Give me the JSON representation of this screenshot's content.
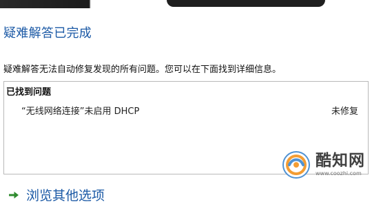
{
  "window": {
    "title": "疑难解答已完成"
  },
  "main": {
    "description": "疑难解答无法自动修复发现的所有问题。您可以在下面找到详细信息。",
    "problems_heading": "已找到问题",
    "problems": [
      {
        "name": "“无线网络连接”未启用 DHCP",
        "status": "未修复"
      }
    ]
  },
  "actions": {
    "browse_other_options": "浏览其他选项"
  },
  "watermark": {
    "name": "酷知网",
    "url": "www.coozhi.com"
  },
  "colors": {
    "title_blue": "#1c5aa6",
    "arrow_green": "#2e8b2e",
    "logo_blue": "#4a8fd3",
    "logo_orange": "#f39a2e"
  },
  "icons": {
    "arrow": "arrow-right-icon",
    "logo": "coozhi-logo-icon"
  }
}
